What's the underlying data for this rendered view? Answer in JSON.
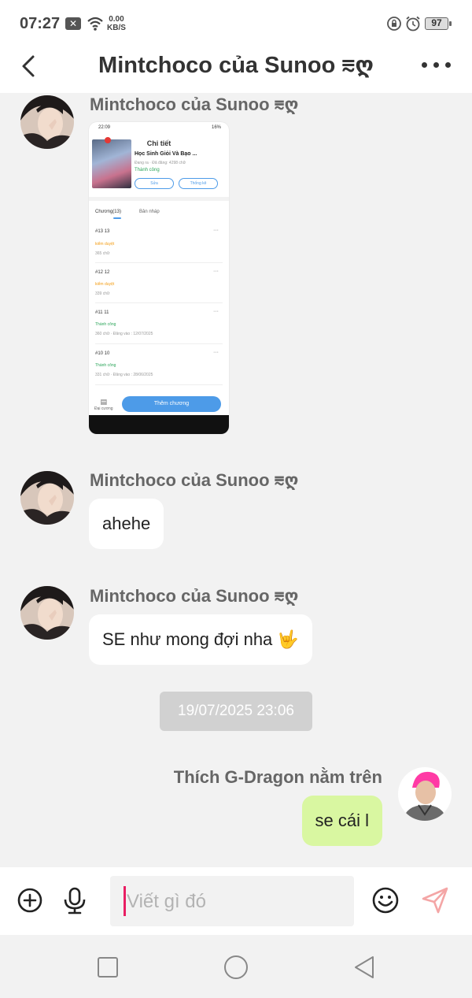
{
  "status_bar": {
    "time": "07:27",
    "net_speed_value": "0.00",
    "net_speed_unit": "KB/S",
    "battery": "97"
  },
  "header": {
    "title": "Mintchoco của Sunoo ⩳ღ"
  },
  "messages": [
    {
      "sender": "Mintchoco của Sunoo ⩳ღ",
      "type": "image"
    },
    {
      "sender": "Mintchoco của Sunoo ⩳ღ",
      "text": "ahehe"
    },
    {
      "sender": "Mintchoco của Sunoo ⩳ღ",
      "text": "SE như mong đợi nha 🤟"
    },
    {
      "timestamp": "19/07/2025 23:06"
    },
    {
      "sender": "Thích G-Dragon nằm trên",
      "text": "se cái l",
      "outgoing": true
    }
  ],
  "shared_screenshot": {
    "status_time": "22:09",
    "battery": "16%",
    "title": "Chi tiết",
    "book_title": "Học Sinh Giỏi Và Bạo ...",
    "book_meta": "Đang ra · Đã đăng: 4298 chữ",
    "status": "Thành công",
    "edit_label": "Sửa",
    "stats_label": "Thống kê",
    "tab_chapters": "Chương(13)",
    "tab_drafts": "Bản nháp",
    "chapters": [
      {
        "title": "#13  13",
        "state": "kiểm duyệt",
        "words": "365 chữ"
      },
      {
        "title": "#12  12",
        "state": "kiểm duyệt",
        "words": "339 chữ"
      },
      {
        "title": "#11  11",
        "state": "Thành công",
        "words": "360 chữ · Đăng vào : 12/07/2025"
      },
      {
        "title": "#10  10",
        "state": "Thành công",
        "words": "331 chữ · Đăng vào : 28/06/2025"
      }
    ],
    "outline_label": "Đại cương",
    "add_chapter": "Thêm chương"
  },
  "input": {
    "placeholder": "Viết gì đó"
  },
  "colors": {
    "outgoing_bubble": "#d9f7a1",
    "incoming_bubble": "#ffffff",
    "cursor": "#e91e63",
    "send_icon": "#f4a6a6"
  }
}
